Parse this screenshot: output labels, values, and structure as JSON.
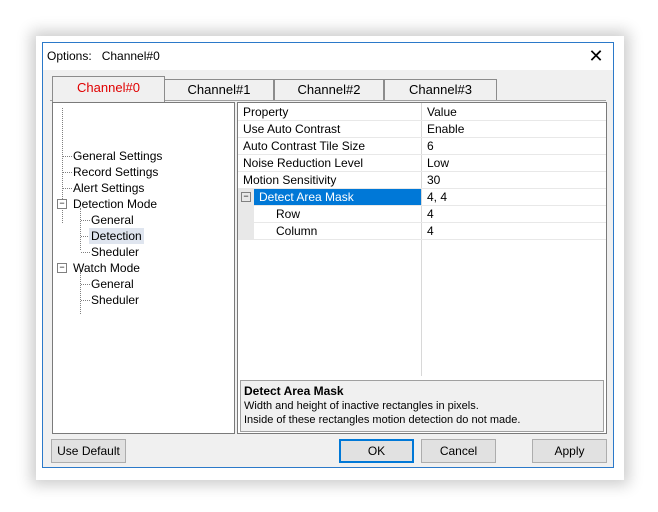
{
  "window": {
    "title": "Options:   Channel#0"
  },
  "tabs": [
    {
      "label": "Channel#0",
      "active": true
    },
    {
      "label": "Channel#1",
      "active": false
    },
    {
      "label": "Channel#2",
      "active": false
    },
    {
      "label": "Channel#3",
      "active": false
    }
  ],
  "tree": {
    "items": [
      {
        "label": "General Settings"
      },
      {
        "label": "Record Settings"
      },
      {
        "label": "Alert Settings"
      },
      {
        "label": "Detection Mode",
        "expanded": true
      },
      {
        "label": "General"
      },
      {
        "label": "Detection",
        "selected": true
      },
      {
        "label": "Sheduler"
      },
      {
        "label": "Watch Mode",
        "expanded": true
      },
      {
        "label": "General"
      },
      {
        "label": "Sheduler"
      }
    ],
    "expander_symbol": "−"
  },
  "grid": {
    "header": {
      "property": "Property",
      "value": "Value"
    },
    "rows": [
      {
        "property": "Use Auto Contrast",
        "value": "Enable"
      },
      {
        "property": "Auto Contrast Tile Size",
        "value": "6"
      },
      {
        "property": "Noise Reduction Level",
        "value": "Low"
      },
      {
        "property": "Motion Sensitivity",
        "value": "30"
      },
      {
        "property": "Detect Area Mask",
        "value": "4, 4",
        "selected": true
      },
      {
        "property": "Row",
        "value": "4"
      },
      {
        "property": "Column",
        "value": "4"
      }
    ],
    "expander_symbol": "−"
  },
  "description": {
    "title": "Detect Area Mask",
    "line1": "Width and height of inactive rectangles in pixels.",
    "line2": "Inside of these rectangles motion detection do not made."
  },
  "buttons": {
    "use_default": "Use Default",
    "ok": "OK",
    "cancel": "Cancel",
    "apply": "Apply"
  },
  "colors": {
    "active_tab_text": "#e00000",
    "selection": "#0078d7",
    "window_border": "#2b79c9"
  }
}
